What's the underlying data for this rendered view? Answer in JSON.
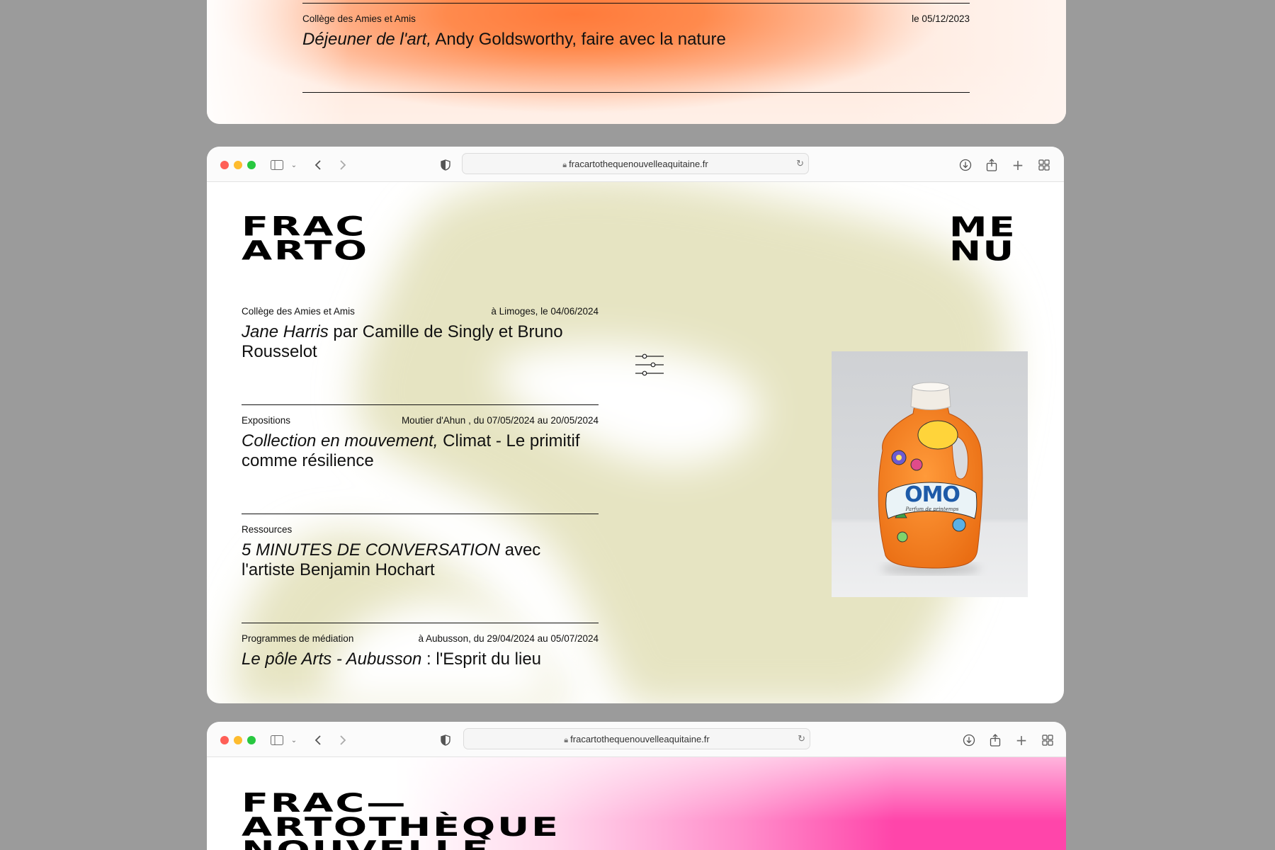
{
  "top_card": {
    "category": "Collège des Amies et Amis",
    "date": "le 05/12/2023",
    "title_italic": "Déjeuner de l'art,",
    "title_rest": " Andy Goldsworthy, faire avec la nature"
  },
  "browser": {
    "url": "fracartothequenouvelleaquitaine.fr",
    "dot_colors": [
      "#ff5f57",
      "#febc2e",
      "#28c840"
    ]
  },
  "main_card": {
    "logo_lines": [
      "FRAC",
      "ARTO"
    ],
    "menu_lines": [
      "ME",
      "NU"
    ],
    "entries": [
      {
        "category": "Collège des Amies et Amis",
        "place_date": "à Limoges, le 04/06/2024",
        "title_italic": "Jane Harris",
        "title_rest": " par Camille de Singly et Bruno Rousselot"
      },
      {
        "category": "Expositions",
        "place_date": "Moutier d'Ahun , du 07/05/2024 au 20/05/2024",
        "title_italic": "Collection en mouvement,",
        "title_rest": " Climat - Le primitif comme résilience"
      },
      {
        "category": "Ressources",
        "place_date": "",
        "title_italic": "5 MINUTES DE CONVERSATION",
        "title_rest": " avec l'artiste Benjamin Hochart"
      },
      {
        "category": "Programmes de médiation",
        "place_date": "à Aubusson, du 29/04/2024 au 05/07/2024",
        "title_italic": "Le pôle Arts - Aubusson",
        "title_rest": " : l'Esprit du lieu"
      }
    ],
    "product_label": "OMO",
    "product_sublabel": "Parfum de printemps"
  },
  "bottom_card": {
    "logo_lines": [
      "FRAC—",
      "ARTOTHÈQUE",
      "NOUVELLE"
    ]
  },
  "colors": {
    "orange": "#ff7a3a",
    "olive_wash": "#e9e7c6",
    "pink": "#ff45aa"
  }
}
